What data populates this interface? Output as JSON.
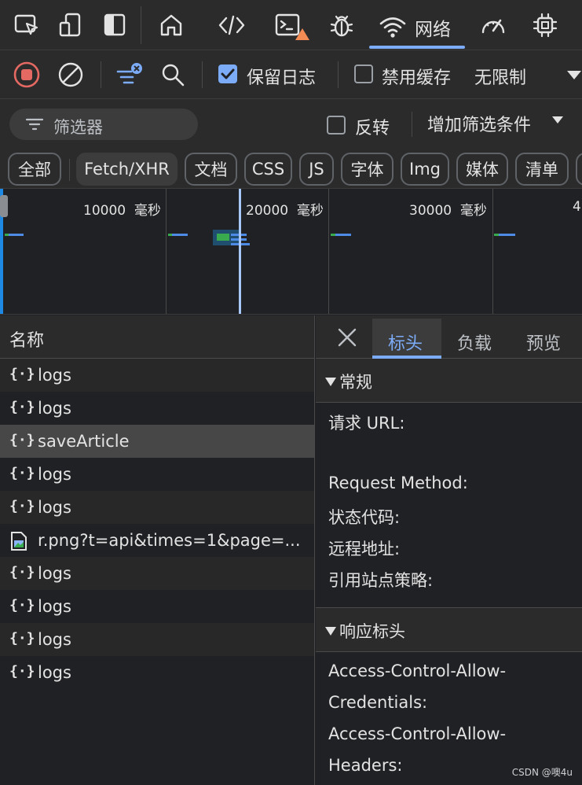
{
  "top_tabs": {
    "network_label": "网络",
    "icons": [
      "inspect-icon",
      "device-emulation-icon",
      "dock-sidebar-icon",
      "welcome-home-icon",
      "elements-code-icon",
      "console-icon",
      "sources-bug-icon",
      "network-wifi-icon",
      "performance-gauge-icon",
      "memory-chip-icon"
    ]
  },
  "toolbar": {
    "preserve_log_label": "保留日志",
    "preserve_log_checked": true,
    "disable_cache_label": "禁用缓存",
    "disable_cache_checked": false,
    "throttling_label": "无限制"
  },
  "filter": {
    "placeholder": "筛选器",
    "invert_label": "反转",
    "invert_checked": false,
    "more_filters_label": "增加筛选条件"
  },
  "type_chips": {
    "items": [
      {
        "label": "全部",
        "active": false
      },
      {
        "label": "Fetch/XHR",
        "active": true
      },
      {
        "label": "文档",
        "active": false
      },
      {
        "label": "CSS",
        "active": false
      },
      {
        "label": "JS",
        "active": false
      },
      {
        "label": "字体",
        "active": false
      },
      {
        "label": "Img",
        "active": false
      },
      {
        "label": "媒体",
        "active": false
      },
      {
        "label": "清单",
        "active": false
      }
    ]
  },
  "timeline": {
    "ticks": [
      {
        "value": "10000",
        "unit": "毫秒"
      },
      {
        "value": "20000",
        "unit": "毫秒"
      },
      {
        "value": "30000",
        "unit": "毫秒"
      },
      {
        "value": "4",
        "unit": ""
      }
    ]
  },
  "request_list": {
    "header": "名称",
    "rows": [
      {
        "name": "logs",
        "type": "xhr",
        "selected": false
      },
      {
        "name": "logs",
        "type": "xhr",
        "selected": false
      },
      {
        "name": "saveArticle",
        "type": "xhr",
        "selected": true
      },
      {
        "name": "logs",
        "type": "xhr",
        "selected": false
      },
      {
        "name": "logs",
        "type": "xhr",
        "selected": false
      },
      {
        "name": "r.png?t=api&times=1&page=...",
        "type": "image",
        "selected": false
      },
      {
        "name": "logs",
        "type": "xhr",
        "selected": false
      },
      {
        "name": "logs",
        "type": "xhr",
        "selected": false
      },
      {
        "name": "logs",
        "type": "xhr",
        "selected": false
      },
      {
        "name": "logs",
        "type": "xhr",
        "selected": false
      }
    ]
  },
  "details": {
    "tabs": [
      "标头",
      "负载",
      "预览"
    ],
    "active_tab": "标头",
    "general": {
      "title": "常规",
      "request_url_label": "请求 URL:",
      "request_method_label": "Request Method:",
      "status_code_label": "状态代码:",
      "remote_address_label": "远程地址:",
      "referrer_policy_label": "引用站点策略:"
    },
    "response_headers": {
      "title": "响应标头",
      "line1": "Access-Control-Allow-",
      "line2": "Credentials:",
      "line3": "Access-Control-Allow-",
      "line4": "Headers:"
    }
  },
  "watermark": "CSDN @噢4u",
  "colors": {
    "accent": "#7cacf8",
    "record": "#e46962",
    "warning": "#f28b54",
    "bar_blue": "#4e8be6",
    "bar_green": "#3aaa4f"
  }
}
